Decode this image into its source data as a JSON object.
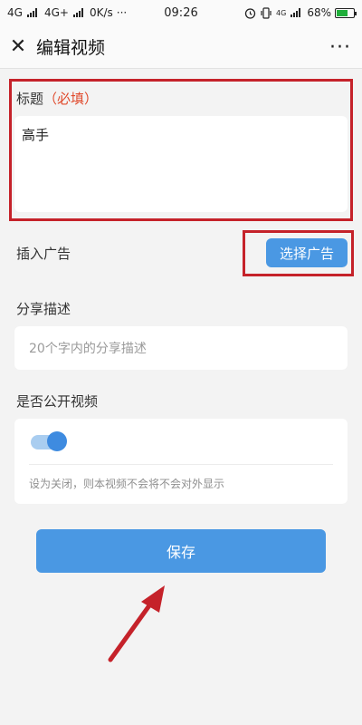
{
  "status_bar": {
    "network1": "4G",
    "network2": "4G+",
    "speed": "0K/s",
    "more": "···",
    "time": "09:26",
    "network3": "4G",
    "battery": "68%",
    "battery_level": 0.68
  },
  "nav": {
    "close_glyph": "✕",
    "title": "编辑视频",
    "more_glyph": "···"
  },
  "form": {
    "title_label": "标题",
    "title_required": "（必填）",
    "title_value": "高手",
    "ad_label": "插入广告",
    "ad_button": "选择广告",
    "share_label": "分享描述",
    "share_placeholder": "20个字内的分享描述",
    "public_label": "是否公开视频",
    "public_toggle_on": true,
    "public_hint": "设为关闭，则本视频不会将不会对外显示",
    "save_button": "保存"
  },
  "annotation": {
    "highlight_color": "#c5222a"
  },
  "colors": {
    "accent": "#4a98e3",
    "required": "#e04a2c"
  },
  "icons": [
    "close-icon",
    "more-icon",
    "signal-icon",
    "alarm-icon",
    "vibrate-icon",
    "battery-icon",
    "annotation-arrow-icon"
  ]
}
